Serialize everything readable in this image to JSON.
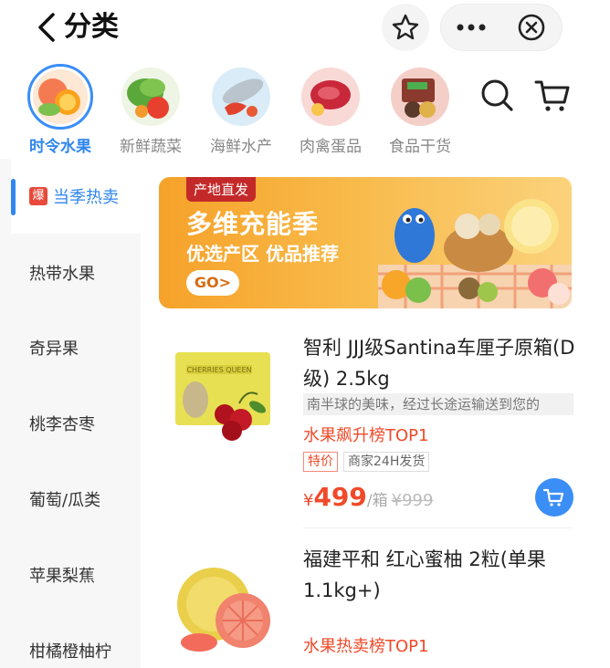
{
  "header": {
    "title": "分类"
  },
  "top_categories": [
    {
      "label": "时令水果",
      "active": true
    },
    {
      "label": "新鲜蔬菜",
      "active": false
    },
    {
      "label": "海鲜水产",
      "active": false
    },
    {
      "label": "肉禽蛋品",
      "active": false
    },
    {
      "label": "食品干货",
      "active": false
    }
  ],
  "sidebar": {
    "hot_badge": "爆",
    "items": [
      {
        "label": "当季热卖",
        "active": true
      },
      {
        "label": "热带水果"
      },
      {
        "label": "奇异果"
      },
      {
        "label": "桃李杏枣"
      },
      {
        "label": "葡萄/瓜类"
      },
      {
        "label": "苹果梨蕉"
      },
      {
        "label": "柑橘橙柚柠"
      }
    ]
  },
  "banner": {
    "tag": "产地直发",
    "headline": "多维充能季",
    "subline": "优选产区 优品推荐",
    "cta": "GO>"
  },
  "products": [
    {
      "title": "智利 JJJ级Santina车厘子原箱(D级) 2.5kg",
      "desc": "南半球的美味，经过长途运输送到您的",
      "rank": "水果飙升榜TOP1",
      "tags": [
        "特价",
        "商家24H发货"
      ],
      "currency": "¥",
      "price": "499",
      "unit": "/箱",
      "old_price": "¥999",
      "box_text": "CHERRIES QUEEN"
    },
    {
      "title": "福建平和 红心蜜柚 2粒(单果1.1kg+)",
      "rank": "水果热卖榜TOP1"
    }
  ],
  "colors": {
    "accent": "#2f86ee",
    "price": "#f04a2a",
    "banner": "#f6a22a"
  }
}
